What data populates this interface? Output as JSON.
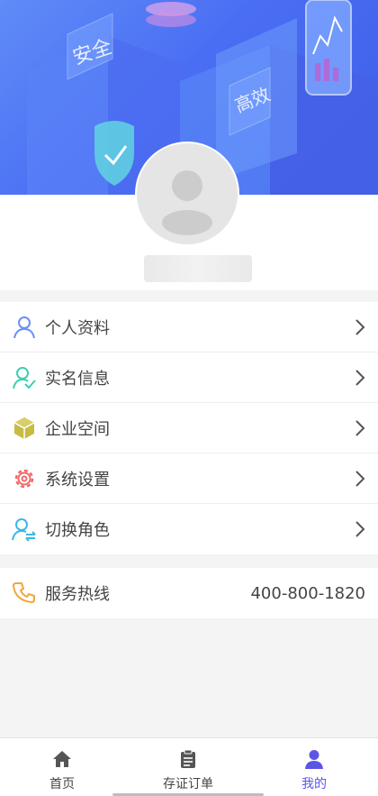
{
  "hero": {
    "badge_safe": "安全",
    "badge_efficient": "高效"
  },
  "menu": {
    "items": [
      {
        "label": "个人资料",
        "icon": "user-icon",
        "color": "#6d8ef5"
      },
      {
        "label": "实名信息",
        "icon": "user-check-icon",
        "color": "#3dcfb0"
      },
      {
        "label": "企业空间",
        "icon": "cube-icon",
        "color": "#b5a83a"
      },
      {
        "label": "系统设置",
        "icon": "gear-icon",
        "color": "#f06a6a"
      },
      {
        "label": "切换角色",
        "icon": "switch-user-icon",
        "color": "#3bb8e8"
      }
    ]
  },
  "service": {
    "label": "服务热线",
    "value": "400-800-1820",
    "icon": "phone-icon",
    "color": "#f0a63c"
  },
  "tabbar": {
    "tabs": [
      {
        "label": "首页",
        "icon": "home-icon"
      },
      {
        "label": "存证订单",
        "icon": "clipboard-icon"
      },
      {
        "label": "我的",
        "icon": "profile-icon",
        "active": true
      }
    ],
    "active_color": "#5b55e6"
  }
}
